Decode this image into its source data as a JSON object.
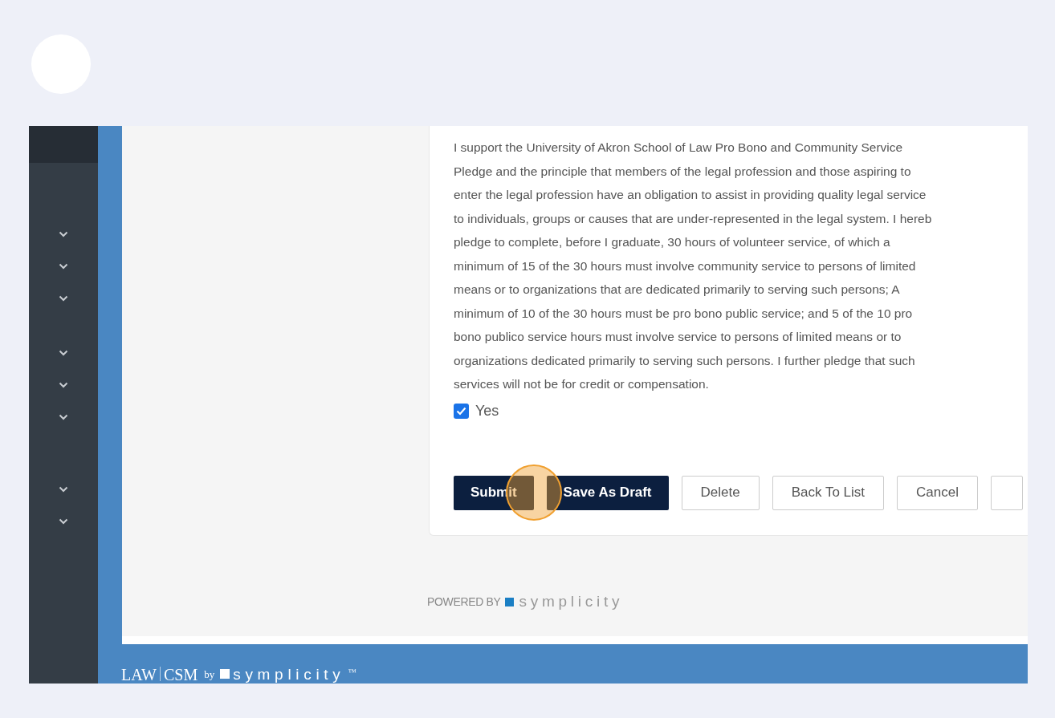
{
  "pledge": {
    "lines": [
      "I support the University of Akron School of Law Pro Bono and Community Service",
      "Pledge and the principle that members of the legal profession and those aspiring to",
      "enter the legal profession have an obligation to assist in providing quality legal service",
      "to individuals, groups or causes that are under-represented in the legal system. I hereb",
      "pledge to complete, before I graduate, 30 hours of volunteer service, of which a",
      "minimum of 15 of the 30 hours must involve community service to persons of limited",
      "means or to organizations that are dedicated primarily to serving such persons; A",
      "minimum of 10 of the 30 hours must be pro bono public service; and 5 of the 10 pro",
      "bono publico service hours must involve service to persons of limited means or to",
      "organizations dedicated primarily to serving such persons. I further pledge that such",
      "services will not be for credit or compensation."
    ],
    "checkbox": {
      "label": "Yes",
      "checked": true
    }
  },
  "buttons": [
    {
      "label": "Submit",
      "kind": "primary"
    },
    {
      "label": "Save As Draft",
      "kind": "primary"
    },
    {
      "label": "Delete",
      "kind": "outline"
    },
    {
      "label": "Back To List",
      "kind": "outline"
    },
    {
      "label": "Cancel",
      "kind": "outline"
    }
  ],
  "powered_by": {
    "text": "POWERED BY",
    "brand": "symplicity"
  },
  "footer_logo": {
    "law": "LAW",
    "csm": "CSM",
    "by": "by",
    "brand": "symplicity",
    "tm": "™"
  }
}
